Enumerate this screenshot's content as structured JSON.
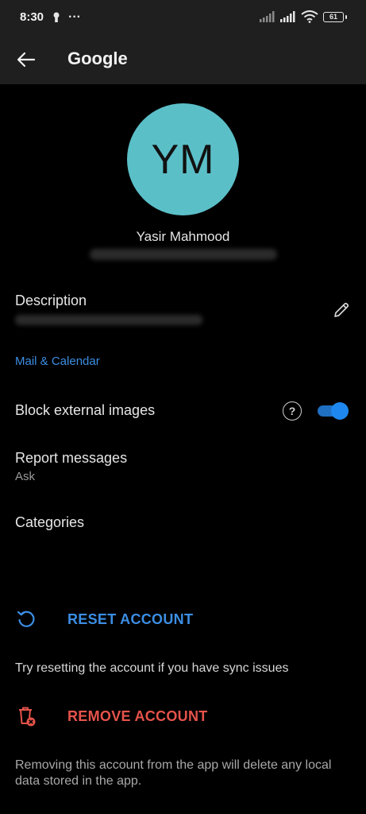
{
  "status_bar": {
    "time": "8:30",
    "more_indicator": "···",
    "battery_level": "61"
  },
  "app_bar": {
    "title": "Google",
    "back_icon": "arrow-left-icon"
  },
  "profile": {
    "initials": "YM",
    "name": "Yasir Mahmood",
    "avatar_color": "#5bbfc8"
  },
  "description": {
    "label": "Description",
    "edit_icon": "pencil-icon"
  },
  "mail_calendar": {
    "section_title": "Mail & Calendar",
    "block_external_images": {
      "label": "Block external images",
      "help_glyph": "?",
      "enabled": true
    },
    "report_messages": {
      "label": "Report messages",
      "value": "Ask"
    },
    "categories": {
      "label": "Categories"
    }
  },
  "reset_account": {
    "label": "RESET ACCOUNT",
    "icon": "reset-icon",
    "description": "Try resetting the account if you have sync issues"
  },
  "remove_account": {
    "label": "REMOVE ACCOUNT",
    "icon": "trash-remove-icon",
    "description_line1": "Removing this account from the app will delete any local",
    "description_line2": "data stored in the app."
  },
  "colors": {
    "accent_blue": "#3c8ee3",
    "danger_red": "#e5534b",
    "toggle_on": "#1e88f0"
  }
}
